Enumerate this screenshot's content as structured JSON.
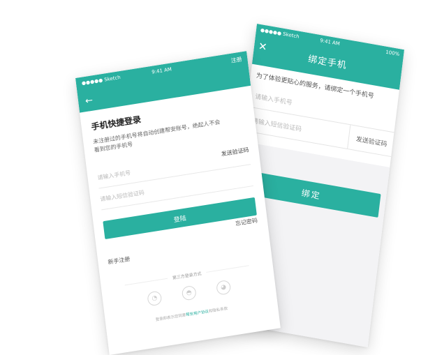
{
  "back_screen": {
    "status": {
      "carrier": "●●●●● Sketch",
      "time": "9:41 AM",
      "battery": "100%"
    },
    "title": "绑定手机",
    "close_icon": "close-icon",
    "hint": "为了体验更贴心的服务，请绑定一个手机号",
    "phone_placeholder": "请输入手机号",
    "code_placeholder": "请输入短信验证码",
    "send_code": "发送验证码",
    "confirm": "绑定"
  },
  "front_screen": {
    "status": {
      "carrier": "●●●●● Sketch",
      "time": "9:41 AM",
      "register": "注册"
    },
    "back_icon": "back-arrow-icon",
    "title": "手机快捷登录",
    "description": "未注册过的手机号将自动创建帮安账号，绝起人不会看到您的手机号",
    "send_code": "发送验证码",
    "phone_placeholder": "请输入手机号",
    "code_placeholder": "请输入短信验证码",
    "login": "登陆",
    "forgot": "忘记密码",
    "new_register": "新手注册",
    "third_party": "第三方登录方式",
    "icons": [
      "wechat-icon",
      "qq-icon",
      "weibo-icon"
    ],
    "agreement_prefix": "登录即表示您同意",
    "agreement_link": "帮安用户协议",
    "agreement_suffix": "和隐私条款"
  },
  "colors": {
    "accent": "#2ab0a0"
  }
}
